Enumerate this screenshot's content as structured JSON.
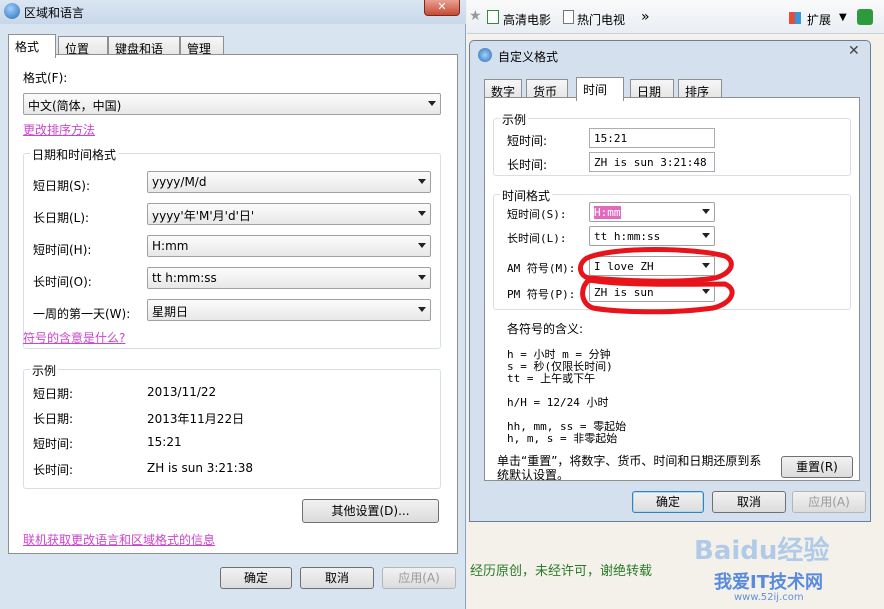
{
  "left": {
    "title": "区域和语言",
    "tabs": [
      "格式",
      "位置",
      "键盘和语言",
      "管理"
    ],
    "format_label": "格式(F):",
    "format_value": "中文(简体，中国)",
    "change_sort_link": "更改排序方法",
    "datetime_group": "日期和时间格式",
    "rows": [
      {
        "label": "短日期(S):",
        "value": "yyyy/M/d"
      },
      {
        "label": "长日期(L):",
        "value": "yyyy'年'M'月'd'日'"
      },
      {
        "label": "短时间(H):",
        "value": "H:mm"
      },
      {
        "label": "长时间(O):",
        "value": "tt h:mm:ss"
      },
      {
        "label": "一周的第一天(W):",
        "value": "星期日"
      }
    ],
    "symbols_link": "符号的含意是什么?",
    "example_group": "示例",
    "examples": [
      {
        "label": "短日期:",
        "value": "2013/11/22"
      },
      {
        "label": "长日期:",
        "value": "2013年11月22日"
      },
      {
        "label": "短时间:",
        "value": "15:21"
      },
      {
        "label": "长时间:",
        "value": "ZH is sun  3:21:38"
      }
    ],
    "other_settings": "其他设置(D)...",
    "online_link": "联机获取更改语言和区域格式的信息",
    "ok": "确定",
    "cancel": "取消",
    "apply": "应用(A)"
  },
  "browser": {
    "hd_movie": "高清电影",
    "hot_tv": "热门电视",
    "chevron": "»",
    "extend": "扩展"
  },
  "right": {
    "title": "自定义格式",
    "tabs": [
      "数字",
      "货币",
      "时间",
      "日期",
      "排序"
    ],
    "example_group": "示例",
    "short_time_label": "短时间:",
    "short_time_value": "15:21",
    "long_time_label": "长时间:",
    "long_time_value": "ZH is sun  3:21:48",
    "time_format_group": "时间格式",
    "fields": [
      {
        "label": "短时间(S):",
        "value": "H:mm"
      },
      {
        "label": "长时间(L):",
        "value": "tt h:mm:ss"
      },
      {
        "label": "AM 符号(M):",
        "value": "I love ZH"
      },
      {
        "label": "PM 符号(P):",
        "value": "ZH is sun"
      }
    ],
    "meaning_title": "各符号的含义:",
    "meaning_lines": [
      "h = 小时   m = 分钟",
      "s = 秒(仅限长时间)",
      "tt = 上午或下午",
      "h/H = 12/24 小时",
      "hh, mm, ss = 零起始",
      "h, m, s = 非零起始"
    ],
    "reset_note_1": "单击“重置”，将数字、货币、时间和日期还原到系",
    "reset_note_2": "统默认设置。",
    "reset": "重置(R)",
    "ok": "确定",
    "cancel": "取消",
    "apply": "应用(A)"
  },
  "footer_text": "经历原创，未经许可，谢绝转载",
  "watermark": {
    "brand": "Baidu经验",
    "site": "我爱IT技术网",
    "url": "www.52ij.com"
  }
}
